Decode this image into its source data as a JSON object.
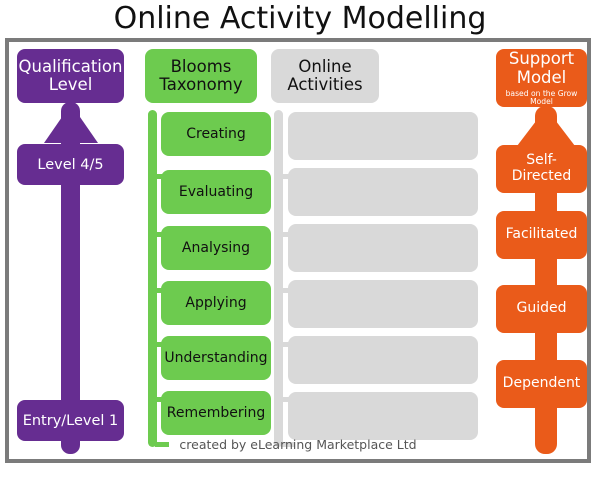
{
  "page": {
    "title": "Online Activity Modelling",
    "footer_credit": "created by eLearning Marketplace Ltd"
  },
  "colors": {
    "purple": "#662D91",
    "green": "#6DCB4F",
    "grey": "#D9D9D9",
    "orange": "#EA5B1A",
    "frame_border": "#7B7B7B",
    "background": "#FFFFFF"
  },
  "columns": {
    "qualification": {
      "header": "Qualification Level",
      "header_line1": "Qualification",
      "header_line2": "Level",
      "arrow_direction": "up",
      "levels": [
        {
          "label": "Level 4/5",
          "position": "middle"
        },
        {
          "label": "Entry/Level 1",
          "position": "bottom"
        }
      ]
    },
    "blooms": {
      "header": "Blooms Taxonomy",
      "header_line1": "Blooms",
      "header_line2": "Taxonomy",
      "items": [
        {
          "label": "Creating"
        },
        {
          "label": "Evaluating"
        },
        {
          "label": "Analysing"
        },
        {
          "label": "Applying"
        },
        {
          "label": "Understanding"
        },
        {
          "label": "Remembering"
        }
      ]
    },
    "online_activities": {
      "header": "Online Activities",
      "header_line1": "Online",
      "header_line2": "Activities",
      "items": [
        {
          "label": ""
        },
        {
          "label": ""
        },
        {
          "label": ""
        },
        {
          "label": ""
        },
        {
          "label": ""
        },
        {
          "label": ""
        }
      ]
    },
    "support_model": {
      "header": "Support Model",
      "header_line1": "Support",
      "header_line2": "Model",
      "subtitle": "based on the Grow Model",
      "arrow_direction": "up",
      "items": [
        {
          "label": "Self-Directed",
          "line1": "Self-",
          "line2": "Directed"
        },
        {
          "label": "Facilitated"
        },
        {
          "label": "Guided"
        },
        {
          "label": "Dependent"
        }
      ]
    }
  }
}
